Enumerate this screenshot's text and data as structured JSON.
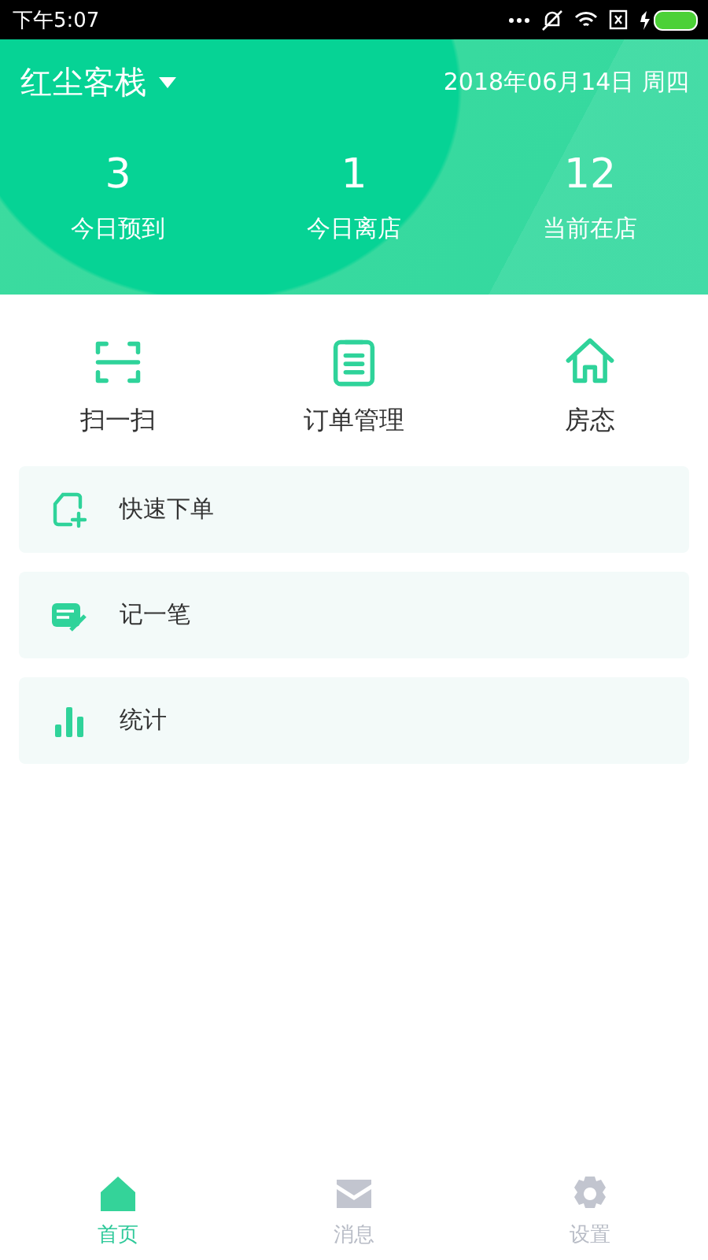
{
  "status_bar": {
    "time": "下午5:07"
  },
  "header": {
    "hotel": "红尘客栈",
    "date": "2018年06月14日 周四"
  },
  "stats": [
    {
      "value": "3",
      "label": "今日预到"
    },
    {
      "value": "1",
      "label": "今日离店"
    },
    {
      "value": "12",
      "label": "当前在店"
    }
  ],
  "actions": [
    {
      "kind": "scan",
      "label": "扫一扫"
    },
    {
      "kind": "order",
      "label": "订单管理"
    },
    {
      "kind": "house",
      "label": "房态"
    }
  ],
  "menu": [
    {
      "kind": "new-order",
      "label": "快速下单"
    },
    {
      "kind": "note",
      "label": "记一笔"
    },
    {
      "kind": "stats",
      "label": "统计"
    }
  ],
  "tabs": [
    {
      "kind": "home",
      "label": "首页",
      "selected": true
    },
    {
      "kind": "message",
      "label": "消息",
      "selected": false
    },
    {
      "kind": "settings",
      "label": "设置",
      "selected": false
    }
  ]
}
